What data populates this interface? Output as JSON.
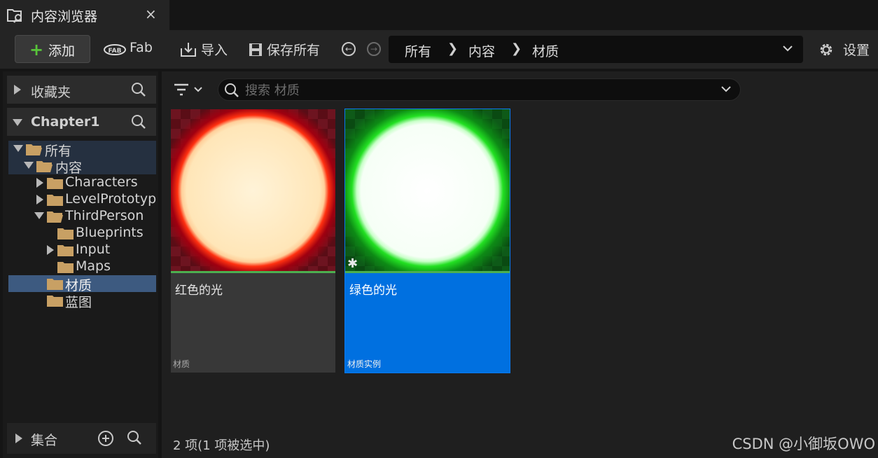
{
  "tab": {
    "title": "内容浏览器",
    "close": "×"
  },
  "toolbar": {
    "add": "添加",
    "fab": "Fab",
    "import": "导入",
    "save_all": "保存所有",
    "settings": "设置"
  },
  "breadcrumb": [
    "所有",
    "内容",
    "材质"
  ],
  "left_panel": {
    "favorites": "收藏夹",
    "project": "Chapter1",
    "collections": "集合",
    "tree": [
      {
        "name": "所有",
        "depth": 0,
        "expanded": true
      },
      {
        "name": "内容",
        "depth": 1,
        "expanded": true
      },
      {
        "name": "Characters",
        "depth": 2,
        "expanded": false
      },
      {
        "name": "LevelPrototyping",
        "depth": 2,
        "expanded": false
      },
      {
        "name": "ThirdPerson",
        "depth": 2,
        "expanded": true
      },
      {
        "name": "Blueprints",
        "depth": 3
      },
      {
        "name": "Input",
        "depth": 3,
        "expanded": false
      },
      {
        "name": "Maps",
        "depth": 3
      },
      {
        "name": "材质",
        "depth": 2,
        "selected": true
      },
      {
        "name": "蓝图",
        "depth": 2
      }
    ]
  },
  "search": {
    "placeholder": "搜索 材质",
    "value": ""
  },
  "assets": [
    {
      "name": "红色的光",
      "type": "材质",
      "glow": "#c80a0a",
      "selected": false
    },
    {
      "name": "绿色的光",
      "type": "材质实例",
      "glow": "#16c816",
      "selected": true
    }
  ],
  "status": "2 项(1 项被选中)",
  "watermark": "CSDN @小御坂OWO",
  "colors": {
    "accent": "#0070e0",
    "folder": "#c8a064",
    "add_plus": "#58c43a"
  }
}
